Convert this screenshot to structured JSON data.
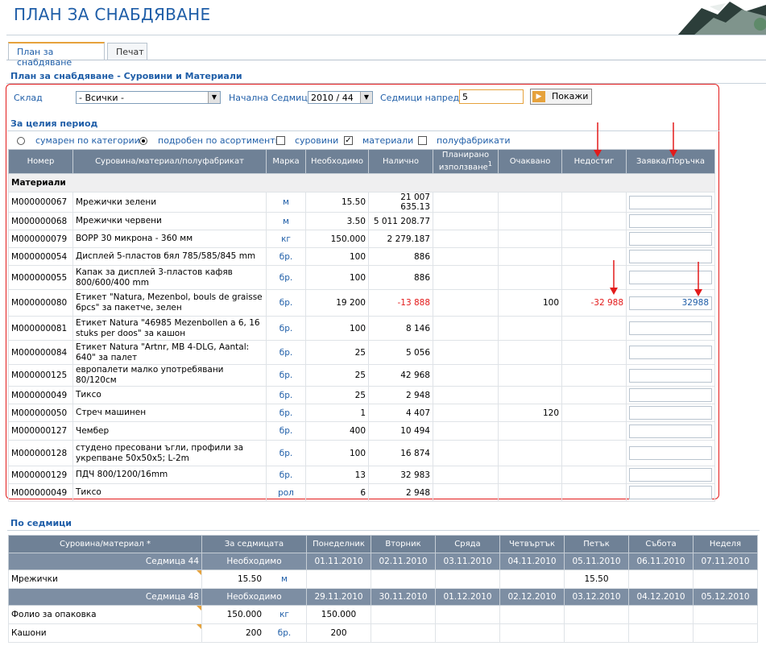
{
  "page_title": "ПЛАН ЗА СНАБДЯВАНЕ",
  "tabs": [
    {
      "label": "План за снабдяване",
      "active": true
    },
    {
      "label": "Печат",
      "active": false
    }
  ],
  "section1_title": "План за снабдяване - Суровини и Материали",
  "filters": {
    "warehouse_label": "Склад",
    "warehouse_value": "- Всички -",
    "start_week_label": "Начална Седмица",
    "start_week_value": "2010 / 44",
    "weeks_ahead_label": "Седмици напред",
    "weeks_ahead_value": "5",
    "show_button": "Покажи"
  },
  "period_title": "За целия период",
  "options": {
    "summary": "сумарен по категории",
    "detailed": "подробен по асортименти",
    "raw": "суровини",
    "materials": "материали",
    "semi": "полуфабрикати",
    "selected_view": "detailed",
    "raw_checked": false,
    "materials_checked": true,
    "semi_checked": false
  },
  "main_table": {
    "headers": [
      "Номер",
      "Суровина/материал/полуфабрикат",
      "Марка",
      "Необходимо",
      "Налично",
      "Планирано използване",
      "1",
      "Очаквано",
      "Недостиг",
      "Заявка/Поръчка"
    ],
    "category": "Материали",
    "rows": [
      {
        "num": "M000000067",
        "name": "Мрежички зелени",
        "unit": "м",
        "need": "15.50",
        "avail": "21 007 635.13",
        "planned": "",
        "expected": "",
        "shortage": "",
        "order": ""
      },
      {
        "num": "M000000068",
        "name": "Мрежички червени",
        "unit": "м",
        "need": "3.50",
        "avail": "5 011 208.77",
        "planned": "",
        "expected": "",
        "shortage": "",
        "order": ""
      },
      {
        "num": "M000000079",
        "name": "BOPP 30 микрона - 360 мм",
        "unit": "кг",
        "need": "150.000",
        "avail": "2 279.187",
        "planned": "",
        "expected": "",
        "shortage": "",
        "order": ""
      },
      {
        "num": "M000000054",
        "name": "Дисплей 5-пластов бял 785/585/845 mm",
        "unit": "бр.",
        "need": "100",
        "avail": "886",
        "planned": "",
        "expected": "",
        "shortage": "",
        "order": ""
      },
      {
        "num": "M000000055",
        "name": "Капак за дисплей 3-пластов кафяв 800/600/400 mm",
        "unit": "бр.",
        "need": "100",
        "avail": "886",
        "planned": "",
        "expected": "",
        "shortage": "",
        "order": ""
      },
      {
        "num": "M000000080",
        "name": "Етикет \"Natura, Mezenbol, bouls de graisse 6pcs\" за пакетче, зелен",
        "unit": "бр.",
        "need": "19 200",
        "avail": "-13 888",
        "planned": "",
        "expected": "100",
        "shortage": "-32 988",
        "order": "32988"
      },
      {
        "num": "M000000081",
        "name": "Етикет Natura \"46985 Mezenbollen a 6, 16 stuks per doos\" за кашон",
        "unit": "бр.",
        "need": "100",
        "avail": "8 146",
        "planned": "",
        "expected": "",
        "shortage": "",
        "order": ""
      },
      {
        "num": "M000000084",
        "name": "Етикет Natura \"Artnr, MB 4-DLG, Aantal: 640\" за палет",
        "unit": "бр.",
        "need": "25",
        "avail": "5 056",
        "planned": "",
        "expected": "",
        "shortage": "",
        "order": ""
      },
      {
        "num": "M000000125",
        "name": "европалети малко употребявани 80/120см",
        "unit": "бр.",
        "need": "25",
        "avail": "42 968",
        "planned": "",
        "expected": "",
        "shortage": "",
        "order": ""
      },
      {
        "num": "M000000049",
        "name": "Тиксо",
        "unit": "бр.",
        "need": "25",
        "avail": "2 948",
        "planned": "",
        "expected": "",
        "shortage": "",
        "order": ""
      },
      {
        "num": "M000000050",
        "name": "Стреч машинен",
        "unit": "бр.",
        "need": "1",
        "avail": "4 407",
        "planned": "",
        "expected": "120",
        "shortage": "",
        "order": ""
      },
      {
        "num": "M000000127",
        "name": "Чембер",
        "unit": "бр.",
        "need": "400",
        "avail": "10 494",
        "planned": "",
        "expected": "",
        "shortage": "",
        "order": ""
      },
      {
        "num": "M000000128",
        "name": "студено пресовани ъгли, профили за укрепване 50x50x5; L-2m",
        "unit": "бр.",
        "need": "100",
        "avail": "16 874",
        "planned": "",
        "expected": "",
        "shortage": "",
        "order": ""
      },
      {
        "num": "M000000129",
        "name": "ПДЧ 800/1200/16mm",
        "unit": "бр.",
        "need": "13",
        "avail": "32 983",
        "planned": "",
        "expected": "",
        "shortage": "",
        "order": ""
      },
      {
        "num": "M000000049",
        "name": "Тиксо",
        "unit": "рол",
        "need": "6",
        "avail": "2 948",
        "planned": "",
        "expected": "",
        "shortage": "",
        "order": ""
      }
    ]
  },
  "weekly_title": "По седмици",
  "weekly": {
    "headers": [
      "Суровина/материал *",
      "За седмицата",
      "Понеделник",
      "Вторник",
      "Сряда",
      "Четвъртък",
      "Петък",
      "Събота",
      "Неделя"
    ],
    "weeks": [
      {
        "week": "Седмица 44",
        "need_label": "Необходимо",
        "dates": [
          "01.11.2010",
          "02.11.2010",
          "03.11.2010",
          "04.11.2010",
          "05.11.2010",
          "06.11.2010",
          "07.11.2010"
        ],
        "items": [
          {
            "name": "Мрежички",
            "qty": "15.50",
            "unit": "м",
            "days": [
              "",
              "",
              "",
              "",
              "15.50",
              "",
              ""
            ]
          }
        ]
      },
      {
        "week": "Седмица 48",
        "need_label": "Необходимо",
        "dates": [
          "29.11.2010",
          "30.11.2010",
          "01.12.2010",
          "02.12.2010",
          "03.12.2010",
          "04.12.2010",
          "05.12.2010"
        ],
        "items": [
          {
            "name": "Фолио за опаковка",
            "qty": "150.000",
            "unit": "кг",
            "days": [
              "150.000",
              "",
              "",
              "",
              "",
              "",
              ""
            ]
          },
          {
            "name": "Кашони",
            "qty": "200",
            "unit": "бр.",
            "days": [
              "200",
              "",
              "",
              "",
              "",
              "",
              ""
            ]
          }
        ]
      }
    ]
  },
  "colors": {
    "accent": "#1f5ea8",
    "header_bg": "#6f8196",
    "annotation": "#e31b1b",
    "orange": "#e6a23c"
  }
}
